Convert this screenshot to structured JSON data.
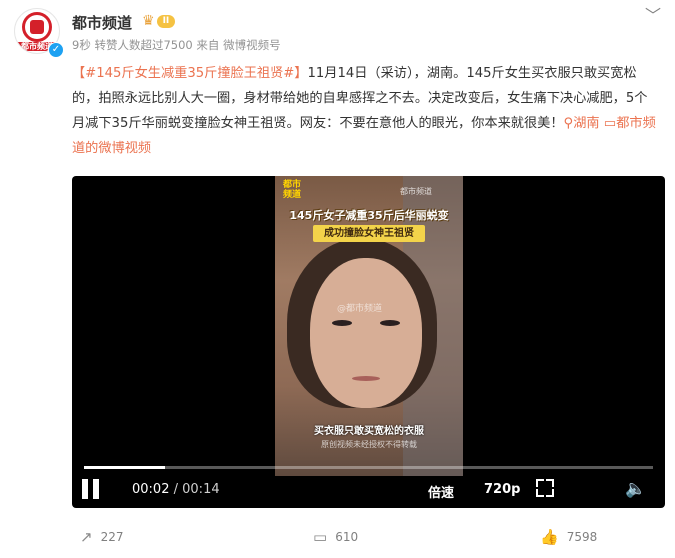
{
  "account": {
    "name": "都市频道",
    "level_badge": "II",
    "avatar_text": "都市频道",
    "time_ago": "9秒",
    "reposts_note": "转赞人数超过7500",
    "source": "来自 微博视频号"
  },
  "post": {
    "hashtag": "【#145斤女生减重35斤撞脸王祖贤#】",
    "body": "11月14日（采访），湖南。145斤女生买衣服只敢买宽松的，拍照永远比别人大一圈，身材带给她的自卑感挥之不去。决定改变后，女生痛下决心减肥，5个月减下35斤华丽蜕变撞脸女神王祖贤。网友：不要在意他人的眼光，你本来就很美！",
    "location": "湖南",
    "video_link": "都市频道的微博视频"
  },
  "video": {
    "logo_text": "都市频道",
    "watermark_top": "都市频道",
    "caption_1": "145斤女子减重35斤后华丽蜕变",
    "caption_2": "成功撞脸女神王祖贤",
    "watermark_face": "@都市频道",
    "subtitle": "买衣服只敢买宽松的衣服",
    "subtitle_small": "原创视频未经授权不得转载",
    "progress_fraction": 0.143,
    "current_time": "00:02",
    "separator": "/",
    "total_time": "00:14",
    "speed_label": "倍速",
    "quality_label": "720p"
  },
  "actions": {
    "repost_count": "227",
    "comment_count": "610",
    "like_count": "7598"
  }
}
